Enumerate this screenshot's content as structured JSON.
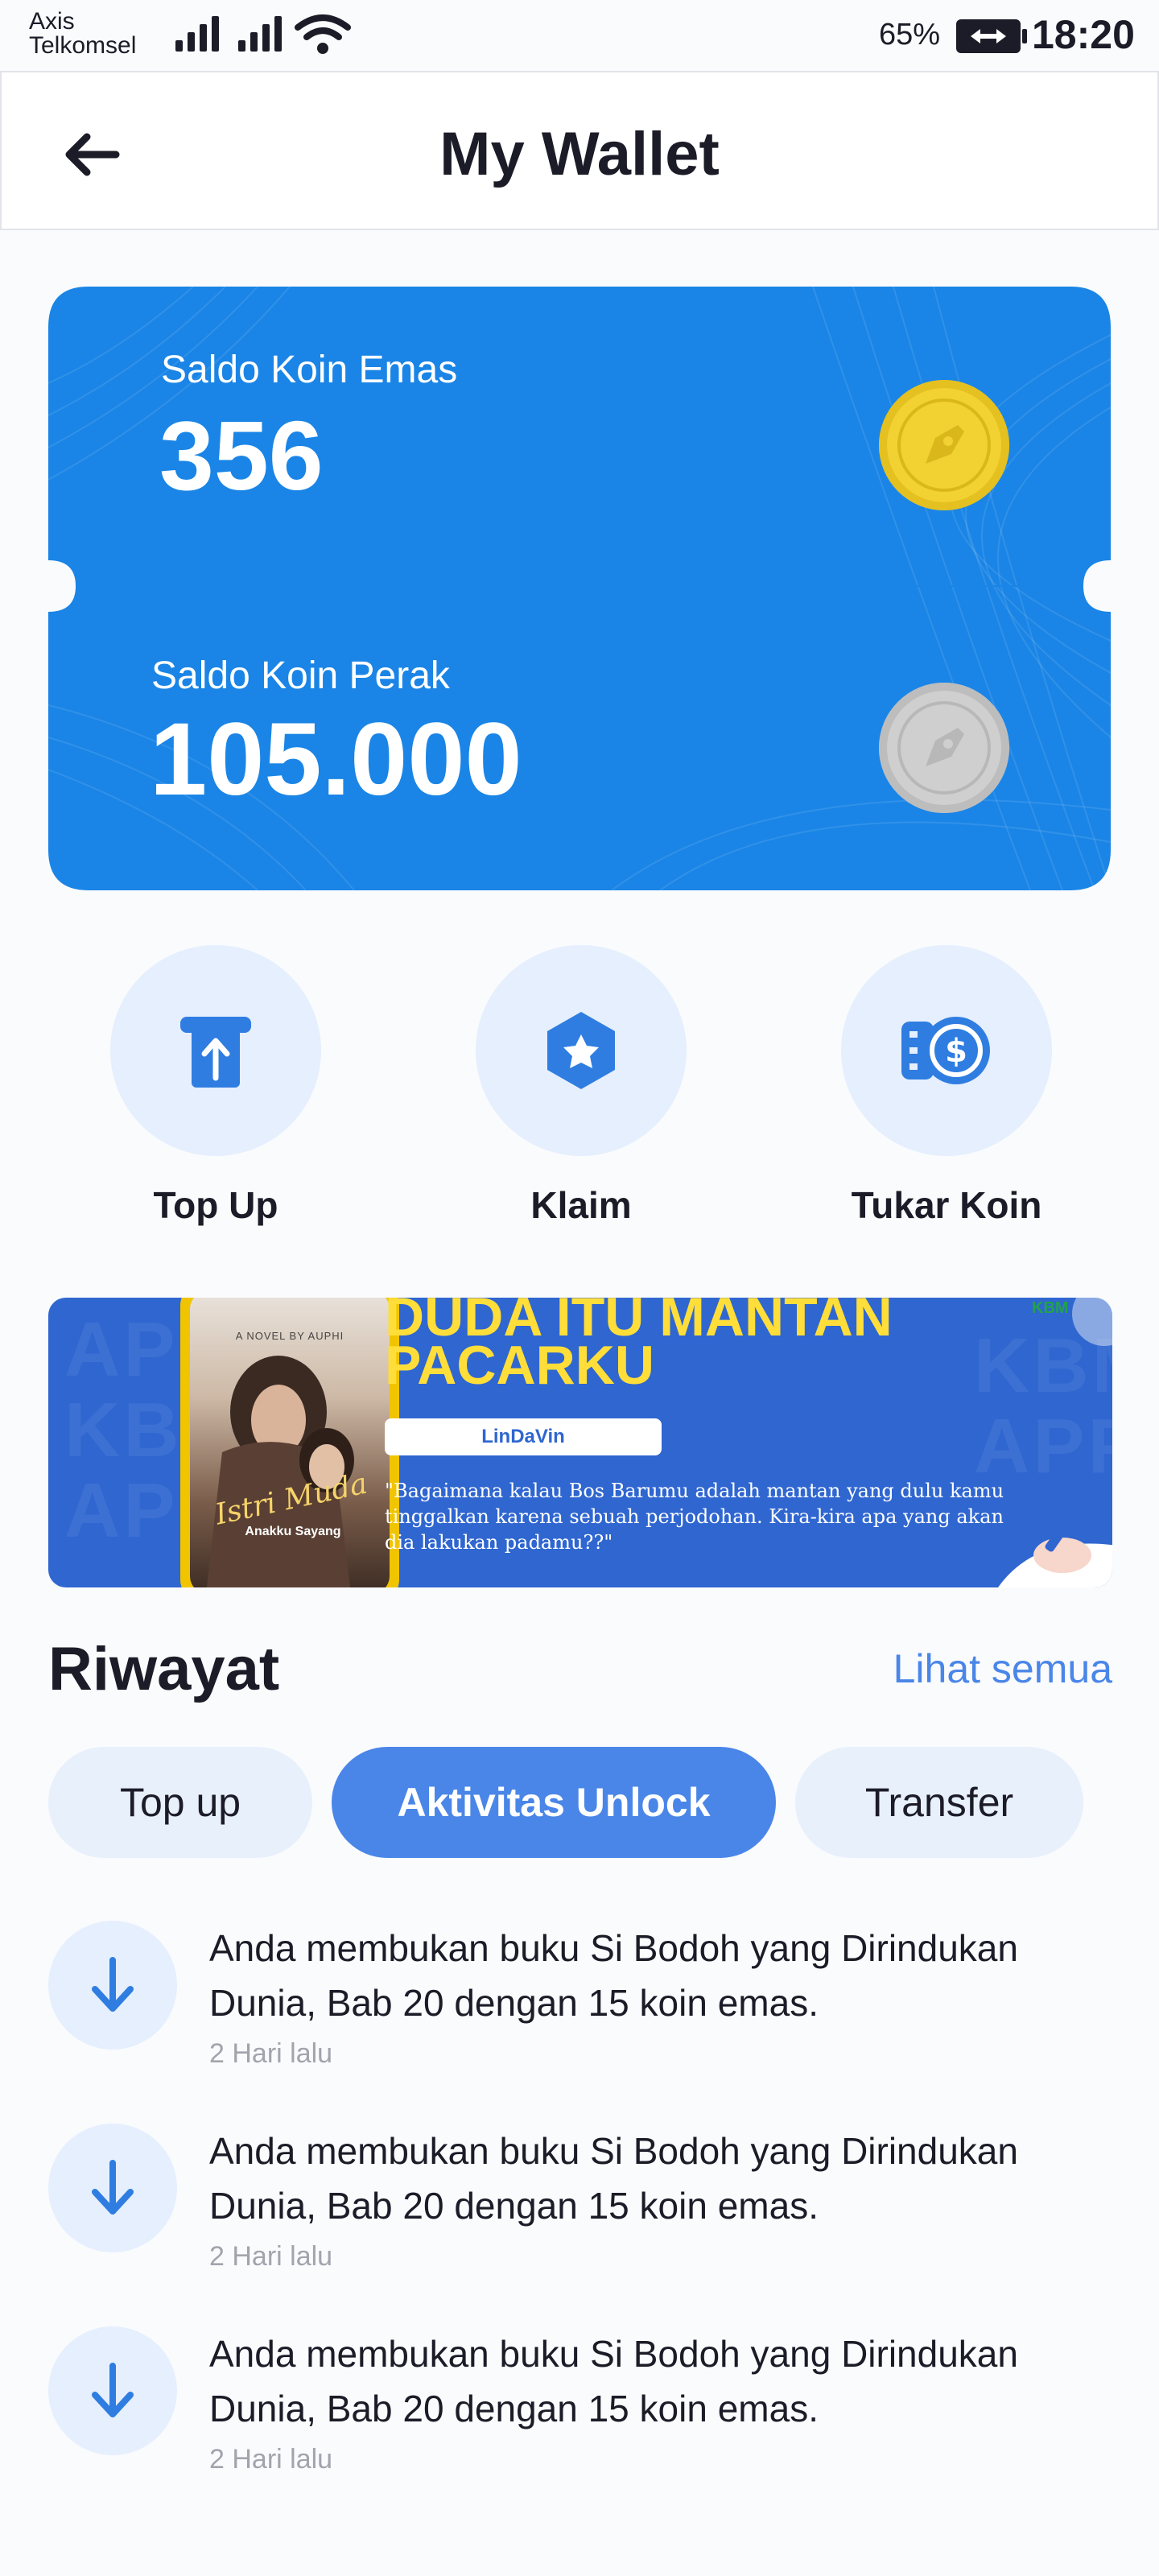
{
  "status_bar": {
    "carrier_line1": "Axis",
    "carrier_line2": "Telkomsel",
    "battery_percent": "65%",
    "time": "18:20"
  },
  "header": {
    "title": "My Wallet",
    "back_icon": "arrow-left-icon"
  },
  "wallet": {
    "gold": {
      "label": "Saldo Koin Emas",
      "value": "356",
      "icon": "gold-coin-icon",
      "color": "#f2d132"
    },
    "silver": {
      "label": "Saldo Koin Perak",
      "value": "105.000",
      "icon": "silver-coin-icon",
      "color": "#c9c9c9"
    },
    "card_color": "#1a85e6"
  },
  "actions": [
    {
      "label": "Top Up",
      "icon": "atm-topup-icon"
    },
    {
      "label": "Klaim",
      "icon": "claim-badge-icon"
    },
    {
      "label": "Tukar Koin",
      "icon": "exchange-coin-icon"
    }
  ],
  "banner": {
    "title_line1": "DUDA ITU MANTAN",
    "title_line2": "PACARKU",
    "author": "LinDaVin",
    "quote": "\"Bagaimana kalau Bos Barumu adalah mantan yang dulu kamu tinggalkan karena sebuah perjodohan. Kira-kira apa yang akan dia lakukan padamu??\"",
    "book_top": "A NOVEL BY AUPHI",
    "book_title": "Istri Muda",
    "book_sub": "Anakku Sayang",
    "brand": "KBM"
  },
  "history": {
    "title": "Riwayat",
    "see_all": "Lihat semua",
    "tabs": [
      {
        "label": "Top up",
        "active": false
      },
      {
        "label": "Aktivitas Unlock",
        "active": true
      },
      {
        "label": "Transfer",
        "active": false
      }
    ],
    "items": [
      {
        "text": "Anda membukan buku Si Bodoh yang Dirindukan Dunia, Bab 20 dengan 15 koin emas.",
        "time": "2 Hari lalu",
        "icon": "arrow-down-icon"
      },
      {
        "text": "Anda membukan buku Si Bodoh yang Dirindukan Dunia, Bab 20 dengan 15 koin emas.",
        "time": "2 Hari lalu",
        "icon": "arrow-down-icon"
      },
      {
        "text": "Anda membukan buku Si Bodoh yang Dirindukan Dunia, Bab 20 dengan 15 koin emas.",
        "time": "2 Hari lalu",
        "icon": "arrow-down-icon"
      }
    ]
  }
}
